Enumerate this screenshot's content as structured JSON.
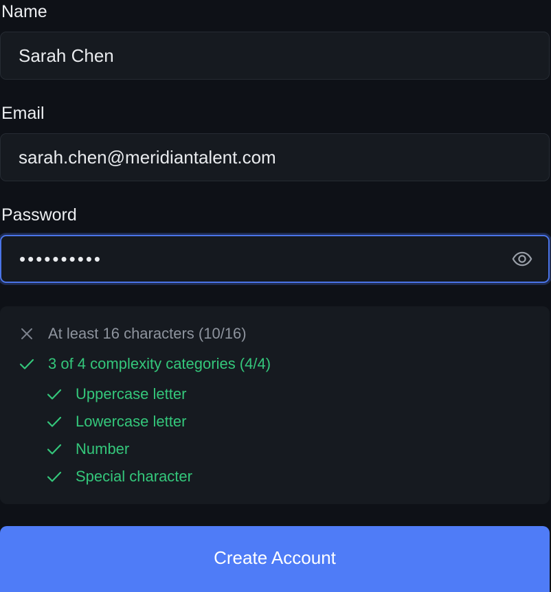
{
  "form": {
    "name": {
      "label": "Name",
      "value": "Sarah Chen"
    },
    "email": {
      "label": "Email",
      "value": "sarah.chen@meridiantalent.com"
    },
    "password": {
      "label": "Password",
      "masked_value": "••••••••••",
      "toggle_icon": "eye-icon"
    }
  },
  "requirements": {
    "length": {
      "text": "At least 16 characters (10/16)",
      "status": "unmet",
      "icon": "x-icon"
    },
    "complexity": {
      "text": "3 of 4 complexity categories (4/4)",
      "status": "met",
      "icon": "check-icon"
    },
    "categories": [
      {
        "text": "Uppercase letter",
        "status": "met"
      },
      {
        "text": "Lowercase letter",
        "status": "met"
      },
      {
        "text": "Number",
        "status": "met"
      },
      {
        "text": "Special character",
        "status": "met"
      }
    ]
  },
  "submit": {
    "label": "Create Account"
  },
  "colors": {
    "background": "#0e1117",
    "input_bg": "#161a20",
    "focus_border": "#4a74e8",
    "met": "#34c77b",
    "unmet": "#8e949e",
    "button": "#4f7cf7"
  }
}
